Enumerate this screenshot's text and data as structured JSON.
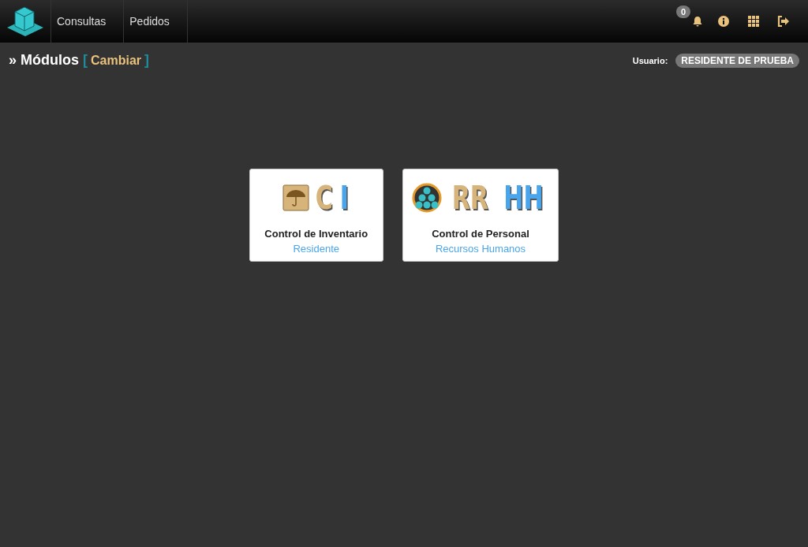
{
  "navbar": {
    "items": [
      {
        "label": "Consultas"
      },
      {
        "label": "Pedidos"
      }
    ],
    "notifications": {
      "count": "0"
    }
  },
  "header": {
    "prefix": "»",
    "title": "Módulos",
    "bracket_open": "[",
    "link": "Cambiar",
    "bracket_close": "]",
    "user_label": "Usuario:",
    "user_name": "RESIDENTE DE PRUEBA"
  },
  "modules": [
    {
      "kind": "inventory",
      "logo_parts": [
        {
          "text": "C",
          "color": "#d6b47a"
        },
        {
          "text": "I",
          "color": "#4aa6ec"
        }
      ],
      "title": "Control de Inventario",
      "subtitle": "Residente"
    },
    {
      "kind": "people",
      "logo_parts": [
        {
          "text": "RR",
          "color": "#d6b47a"
        },
        {
          "text": "HH",
          "color": "#4aa6ec"
        }
      ],
      "title": "Control de Personal",
      "subtitle": "Recursos Humanos"
    }
  ]
}
